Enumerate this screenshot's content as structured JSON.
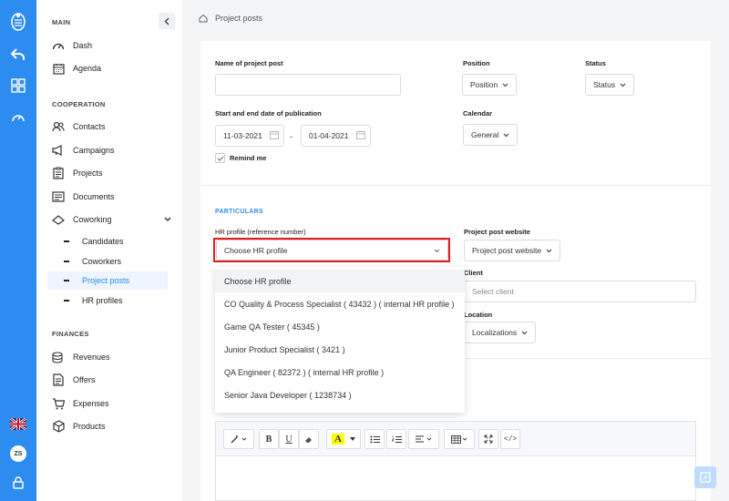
{
  "breadcrumb": {
    "label": "Project posts"
  },
  "sidebar": {
    "main_title": "MAIN",
    "main_items": [
      {
        "label": "Dash",
        "icon": "gauge-icon"
      },
      {
        "label": "Agenda",
        "icon": "calendar-icon"
      }
    ],
    "cooperation_title": "COOPERATION",
    "cooperation_items": [
      {
        "label": "Contacts",
        "icon": "contacts-icon"
      },
      {
        "label": "Campaigns",
        "icon": "megaphone-icon"
      },
      {
        "label": "Projects",
        "icon": "clipboard-icon"
      },
      {
        "label": "Documents",
        "icon": "document-icon"
      },
      {
        "label": "Coworking",
        "icon": "coworking-icon"
      }
    ],
    "coworking_sub": [
      {
        "label": "Candidates"
      },
      {
        "label": "Coworkers"
      },
      {
        "label": "Project posts",
        "active": true
      },
      {
        "label": "HR profiles"
      }
    ],
    "finances_title": "FINANCES",
    "finances_items": [
      {
        "label": "Revenues",
        "icon": "coins-icon"
      },
      {
        "label": "Offers",
        "icon": "offer-icon"
      },
      {
        "label": "Expenses",
        "icon": "cart-icon"
      },
      {
        "label": "Products",
        "icon": "box-icon"
      }
    ]
  },
  "rail": {
    "avatar_initials": "ZS"
  },
  "form": {
    "name_label": "Name of project post",
    "name_value": "",
    "position_label": "Position",
    "position_value": "Position",
    "status_label": "Status",
    "status_value": "Status",
    "dates_label": "Start and end date of publication",
    "start_date": "11-03-2021",
    "date_separator": "-",
    "end_date": "01-04-2021",
    "calendar_label": "Calendar",
    "calendar_value": "General",
    "remind_label": "Remind me",
    "remind_checked": true,
    "particulars_title": "PARTICULARS",
    "hr_profile_label": "HR profile (reference number)",
    "hr_profile_value": "Choose HR profile",
    "website_label": "Project post website",
    "website_value": "Project post website",
    "client_label": "Client",
    "client_placeholder": "Select client",
    "location_label": "Location",
    "location_value": "Localizations"
  },
  "dropdown": {
    "options": [
      {
        "label": "Choose HR profile",
        "selected": true
      },
      {
        "label": "CO Quality & Process Specialist ( 43432 ) ( internal HR profile )"
      },
      {
        "label": "Game QA Tester ( 45345 )"
      },
      {
        "label": "Junior Product Specialist ( 3421 )"
      },
      {
        "label": "QA Engineer ( 82372 ) ( internal HR profile )"
      },
      {
        "label": "Senior Java Developer ( 1238734 )"
      }
    ]
  },
  "editor_toolbar": {
    "bold": "B",
    "underline": "U",
    "font_color": "A",
    "code": "</>"
  },
  "colors": {
    "accent": "#2d8cf0",
    "highlight": "#e02020",
    "font_color_bg": "#ffff00"
  }
}
